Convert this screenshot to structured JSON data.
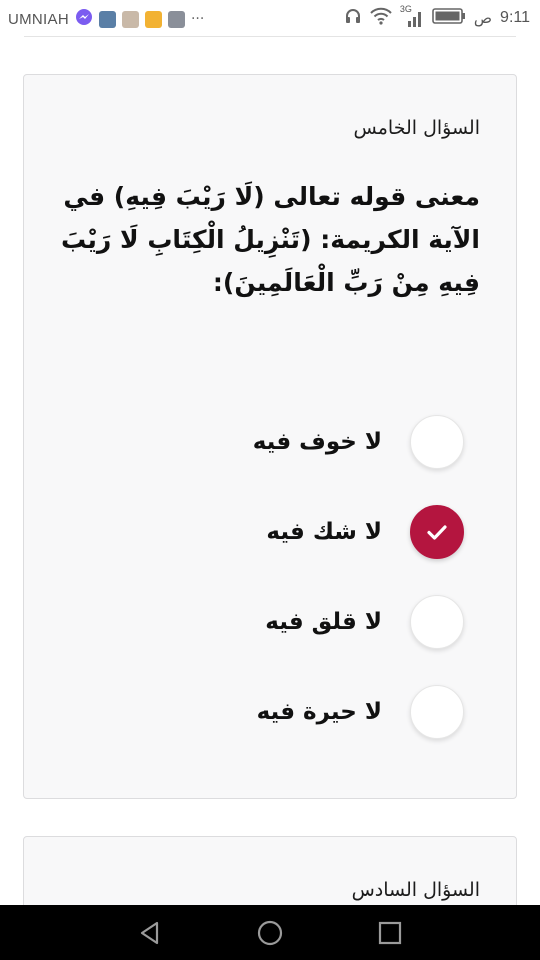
{
  "status_bar": {
    "carrier": "UMNIAH",
    "overflow": "···",
    "network": "3G",
    "time": "9:11",
    "ampm": "ص",
    "icons": [
      "messenger-icon",
      "photo-icon",
      "avatar-icon",
      "lock-app-icon",
      "gallery-icon",
      "headset-icon",
      "wifi-icon",
      "signal-icon",
      "battery-icon"
    ]
  },
  "question_5": {
    "label": "السؤال الخامس",
    "text": "معنى قوله تعالى (لَا رَيْبَ فِيهِ) في الآية الكريمة: (تَنْزِيلُ الْكِتَابِ لَا رَيْبَ فِيهِ مِنْ رَبِّ الْعَالَمِينَ):",
    "options": [
      {
        "label": "لا خوف فيه",
        "selected": false
      },
      {
        "label": "لا شك فيه",
        "selected": true
      },
      {
        "label": "لا قلق فيه",
        "selected": false
      },
      {
        "label": "لا حيرة فيه",
        "selected": false
      }
    ]
  },
  "question_6": {
    "label": "السؤال السادس"
  },
  "colors": {
    "accent": "#b4153f",
    "card_bg": "#f8f8f9",
    "nav_bg": "#000000"
  },
  "nav": [
    "back-icon",
    "home-icon",
    "recents-icon"
  ]
}
